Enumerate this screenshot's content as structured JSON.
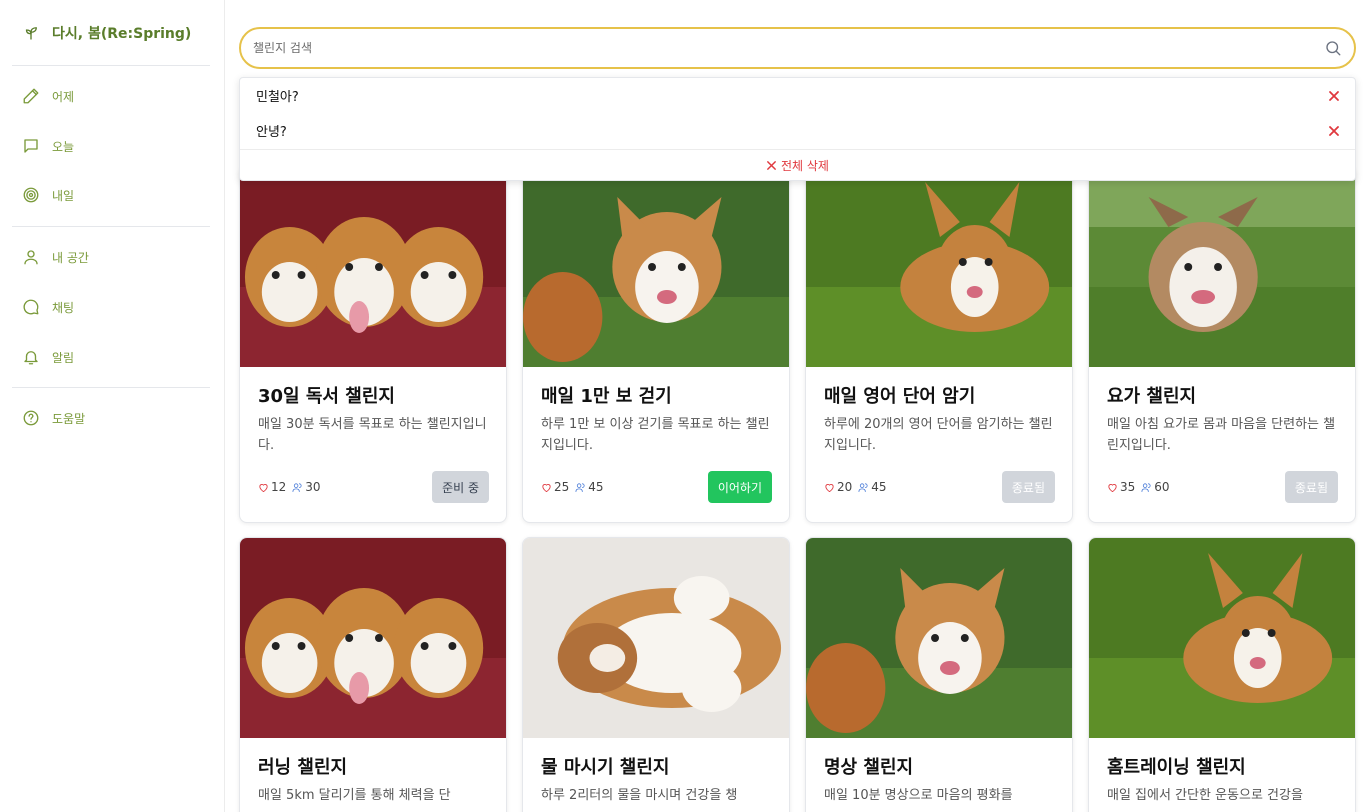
{
  "app": {
    "brand": "다시, 봄(Re:Spring)"
  },
  "sidebar": {
    "items": [
      {
        "label": "어제",
        "icon": "pencil-icon"
      },
      {
        "label": "오늘",
        "icon": "message-square-icon"
      },
      {
        "label": "내일",
        "icon": "target-icon"
      },
      {
        "label": "내 공간",
        "icon": "user-icon"
      },
      {
        "label": "채팅",
        "icon": "chat-bubble-icon"
      },
      {
        "label": "알림",
        "icon": "bell-icon"
      },
      {
        "label": "도움말",
        "icon": "help-circle-icon"
      }
    ]
  },
  "search": {
    "placeholder": "챌린지 검색",
    "value": "",
    "history": [
      "민철아?",
      "안녕?"
    ],
    "clear_all_label": "전체 삭제"
  },
  "colors": {
    "brand": "#5a7d2b",
    "accent": "#e6c24a",
    "danger": "#e0383e",
    "success": "#22c55e"
  },
  "cards": [
    {
      "title": "30일 독서 챌린지",
      "desc": "매일 30분 독서를 목표로 하는 챌린지입니다.",
      "likes": "12",
      "participants": "30",
      "status": "준비 중",
      "image": "three-corgi-puppies"
    },
    {
      "title": "매일 1만 보 걷기",
      "desc": "하루 1만 보 이상 걷기를 목표로 하는 챌린지입니다.",
      "likes": "25",
      "participants": "45",
      "status": "이어하기",
      "image": "corgi-puppies-on-grass"
    },
    {
      "title": "매일 영어 단어 암기",
      "desc": "하루에 20개의 영어 단어를 암기하는 챌린지입니다.",
      "likes": "20",
      "participants": "45",
      "status": "종료됨",
      "image": "corgi-in-grass"
    },
    {
      "title": "요가 챌린지",
      "desc": "매일 아침 요가로 몸과 마음을 단련하는 챌린지입니다.",
      "likes": "35",
      "participants": "60",
      "status": "종료됨",
      "image": "running-corgi-puppy"
    },
    {
      "title": "러닝 챌린지",
      "desc": "매일 5km 달리기를 통해 체력을 단",
      "image": "three-corgi-puppies"
    },
    {
      "title": "물 마시기 챌린지",
      "desc": "하루 2리터의 물을 마시며 건강을 챙",
      "image": "sleeping-puppy"
    },
    {
      "title": "명상 챌린지",
      "desc": "매일 10분 명상으로 마음의 평화를",
      "image": "corgi-puppies-on-grass"
    },
    {
      "title": "홈트레이닝 챌린지",
      "desc": "매일 집에서 간단한 운동으로 건강을",
      "image": "corgi-in-grass"
    }
  ]
}
